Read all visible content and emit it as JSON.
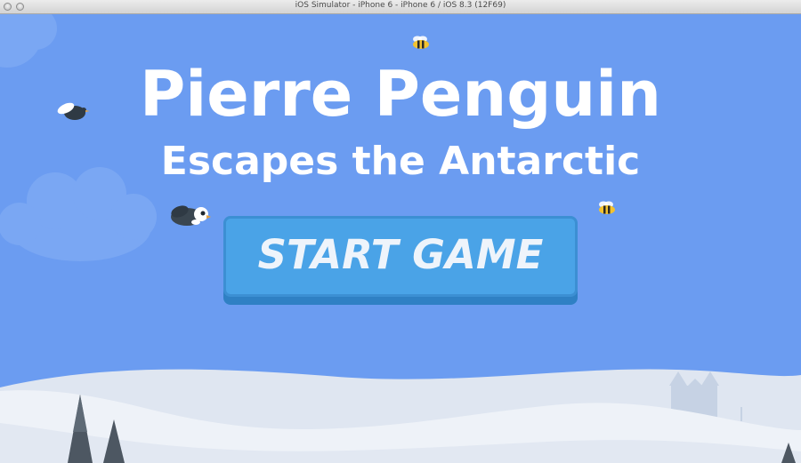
{
  "window": {
    "title": "iOS Simulator - iPhone 6 - iPhone 6 / iOS 8.3 (12F69)"
  },
  "game": {
    "title_line1": "Pierre Penguin",
    "title_line2": "Escapes the Antarctic",
    "start_button_label": "START GAME"
  },
  "colors": {
    "sky": "#6b9cf1",
    "button_face": "#4aa3e7",
    "button_shadow": "#2f80c4",
    "snow": "#eef2f8"
  },
  "sprites": [
    "penguin",
    "flying-bird",
    "bee",
    "bee",
    "cloud",
    "ice-castle",
    "pine-tree"
  ]
}
